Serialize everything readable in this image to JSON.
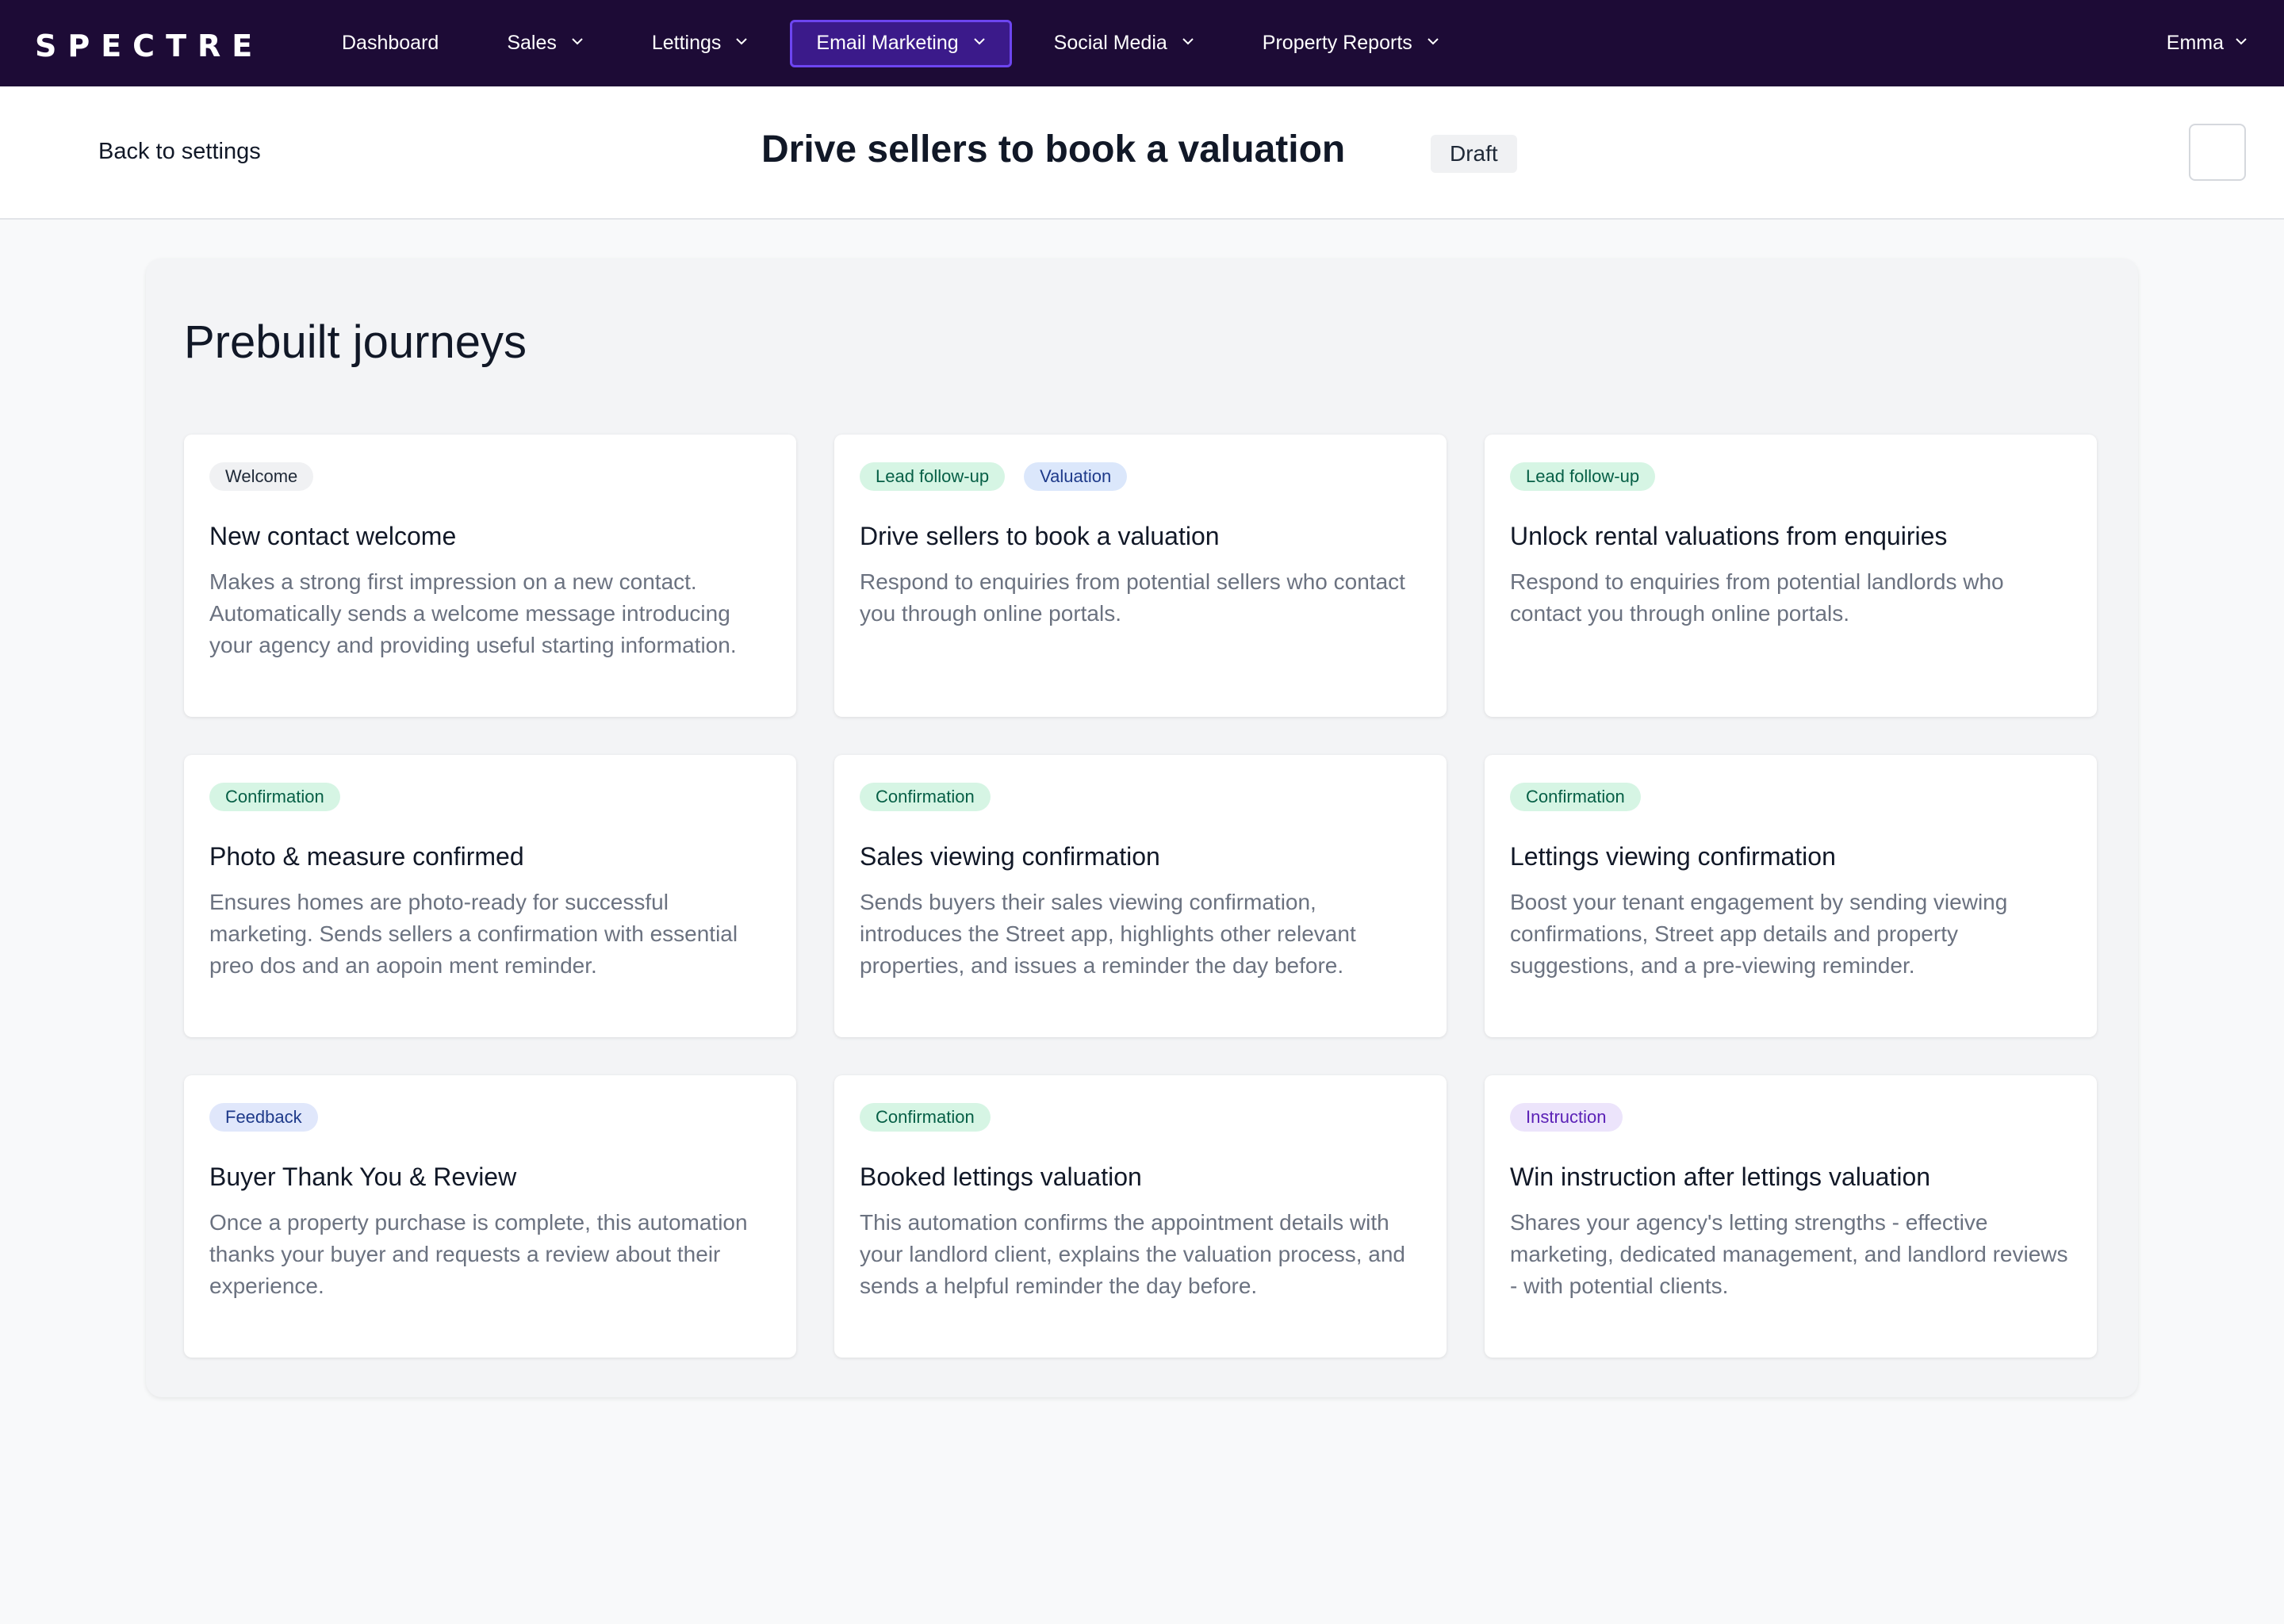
{
  "app": {
    "logo": "SPECTRE"
  },
  "nav": {
    "items": [
      {
        "label": "Dashboard",
        "has_dropdown": false,
        "active": false
      },
      {
        "label": "Sales",
        "has_dropdown": true,
        "active": false
      },
      {
        "label": "Lettings",
        "has_dropdown": true,
        "active": false
      },
      {
        "label": "Email Marketing",
        "has_dropdown": true,
        "active": true
      },
      {
        "label": "Social Media",
        "has_dropdown": true,
        "active": false
      },
      {
        "label": "Property Reports",
        "has_dropdown": true,
        "active": false
      }
    ],
    "user": "Emma"
  },
  "header": {
    "back_label": "Back to settings",
    "title": "Drive sellers to book a valuation",
    "status_badge": "Draft"
  },
  "panel": {
    "title": "Prebuilt journeys",
    "cards": [
      {
        "tags": [
          "Welcome"
        ],
        "title": "New contact welcome",
        "description": "Makes a strong first impression on a new contact. Automatically sends a welcome message introducing your agency and providing useful starting information."
      },
      {
        "tags": [
          "Lead follow-up",
          "Valuation"
        ],
        "title": "Drive sellers to book a valuation",
        "description": "Respond to enquiries from potential sellers who contact you through online portals."
      },
      {
        "tags": [
          "Lead follow-up"
        ],
        "title": "Unlock rental valuations from enquiries",
        "description": "Respond to enquiries from potential landlords who contact you through online portals."
      },
      {
        "tags": [
          "Confirmation"
        ],
        "title": "Photo & measure confirmed",
        "description": "Ensures homes are photo-ready for successful marketing. Sends sellers a confirmation with essential preo dos and an aopoin ment reminder."
      },
      {
        "tags": [
          "Confirmation"
        ],
        "title": "Sales viewing confirmation",
        "description": "Sends buyers their sales viewing confirmation, introduces the Street app, highlights other relevant properties, and issues a reminder the day before."
      },
      {
        "tags": [
          "Confirmation"
        ],
        "title": "Lettings viewing confirmation",
        "description": "Boost your tenant engagement by sending viewing confirmations, Street app details and property suggestions, and a pre-viewing reminder."
      },
      {
        "tags": [
          "Feedback"
        ],
        "title": "Buyer Thank You & Review",
        "description": "Once a property purchase is complete, this automation thanks your buyer and requests a review about their experience."
      },
      {
        "tags": [
          "Confirmation"
        ],
        "title": "Booked lettings valuation",
        "description": "This automation confirms the appointment details with your landlord client, explains the valuation process, and sends a helpful reminder the day before."
      },
      {
        "tags": [
          "Instruction"
        ],
        "title": "Win instruction after lettings valuation",
        "description": "Shares your agency's letting strengths - effective marketing, dedicated management, and landlord reviews - with potential clients."
      }
    ]
  },
  "tag_styles": {
    "Welcome": {
      "bg": "#f0f1f3",
      "fg": "#1f2937"
    },
    "Lead follow-up": {
      "bg": "#d6f5e4",
      "fg": "#065f46"
    },
    "Valuation": {
      "bg": "#dbe7fb",
      "fg": "#1e3a8a"
    },
    "Confirmation": {
      "bg": "#d6f5e4",
      "fg": "#065f46"
    },
    "Feedback": {
      "bg": "#e0e7fb",
      "fg": "#1e3a8a"
    },
    "Instruction": {
      "bg": "#ece4fb",
      "fg": "#5b21b6"
    }
  },
  "colors": {
    "nav_bg": "#1d0b36",
    "nav_active_bg": "#3b1a8a",
    "nav_active_border": "#6d45f0"
  }
}
